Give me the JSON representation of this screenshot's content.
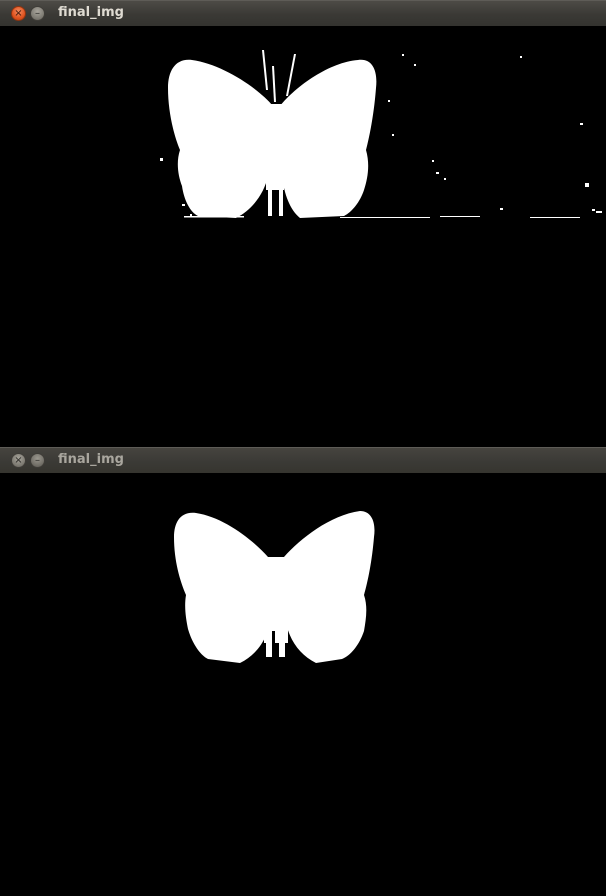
{
  "windows": [
    {
      "title": "final_img",
      "active": true,
      "close_glyph": "×",
      "minimize_glyph": "–"
    },
    {
      "title": "final_img",
      "active": false,
      "close_glyph": "×",
      "minimize_glyph": "–"
    }
  ],
  "colors": {
    "canvas_background": "#000000",
    "mask_foreground": "#ffffff",
    "close_button": "#e0531f",
    "title_text": "#dfdbd2"
  },
  "icons": {
    "close": "close-icon",
    "minimize": "minimize-icon"
  }
}
